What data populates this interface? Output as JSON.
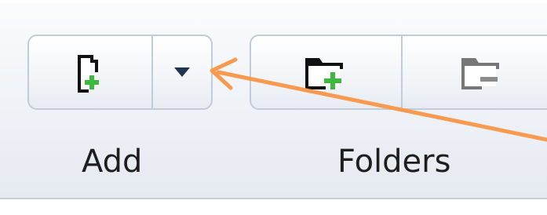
{
  "ribbon": {
    "groups": [
      {
        "label": "Add",
        "buttons": [
          {
            "icon": "new-document-plus-icon"
          },
          {
            "icon": "dropdown-triangle-icon"
          }
        ]
      },
      {
        "label": "Folders",
        "buttons": [
          {
            "icon": "new-folder-plus-icon"
          },
          {
            "icon": "remove-folder-minus-icon"
          }
        ]
      }
    ]
  },
  "annotation": {
    "type": "arrow",
    "color": "#f79a4f",
    "points_to": "add-dropdown-button"
  },
  "colors": {
    "plus_green": "#3fb83f",
    "minus_gray": "#8c8c8c",
    "dropdown_arrow": "#1f3552",
    "annotation_orange": "#f79a4f"
  }
}
